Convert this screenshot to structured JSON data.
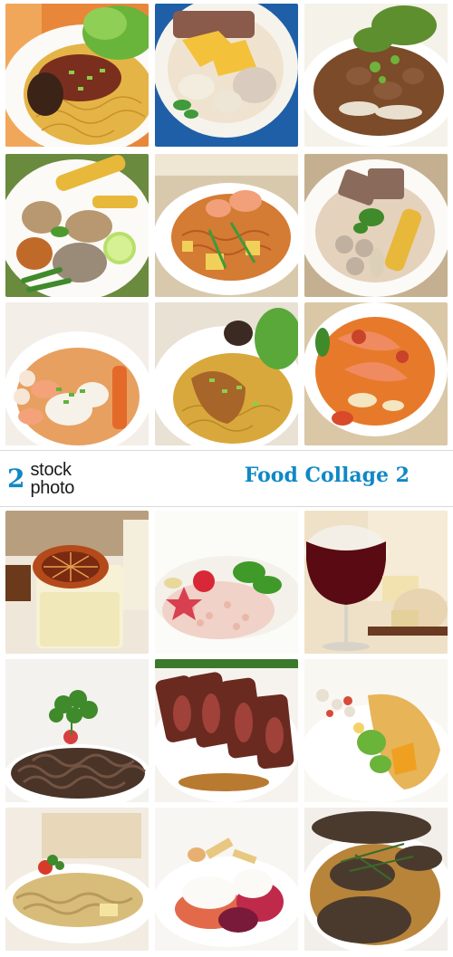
{
  "header": {
    "brand_digit": "2",
    "brand_line1": "stock",
    "brand_line2": "photo",
    "title": "Food Collage 2"
  },
  "top_photos": [
    {
      "subject": "egg-noodles-with-braised-pork"
    },
    {
      "subject": "noodle-soup-with-fried-wonton"
    },
    {
      "subject": "beef-noodle-soup-with-greens"
    },
    {
      "subject": "noodle-plate-with-corn-and-lime"
    },
    {
      "subject": "pad-thai-with-shrimp"
    },
    {
      "subject": "noodle-plate-with-corn-and-meatballs"
    },
    {
      "subject": "shrimp-noodle-soup"
    },
    {
      "subject": "egg-noodles-with-chicken-leg"
    },
    {
      "subject": "spicy-shrimp-soup"
    }
  ],
  "bottom_photos": [
    {
      "subject": "dessert-glass-with-dried-orange"
    },
    {
      "subject": "risotto-with-strawberry"
    },
    {
      "subject": "red-wine-and-cheese"
    },
    {
      "subject": "dark-pasta-with-parsley"
    },
    {
      "subject": "sliced-steak"
    },
    {
      "subject": "crepe-with-salad"
    },
    {
      "subject": "creamy-pasta-with-tomato"
    },
    {
      "subject": "beet-dessert-with-cream"
    },
    {
      "subject": "liver-with-herbs"
    }
  ],
  "colors": {
    "brand_blue": "#1188c6",
    "noodle_yellow": "#e0b040",
    "broth_orange": "#d9782c",
    "lettuce_green": "#7cbf3a"
  }
}
